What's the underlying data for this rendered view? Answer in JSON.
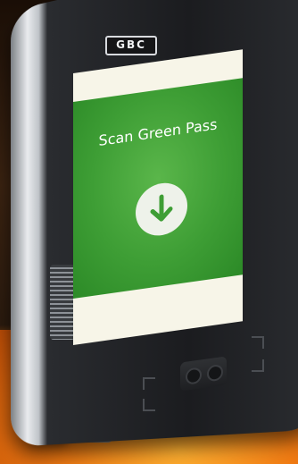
{
  "device": {
    "brand_logo": "GBC"
  },
  "screen": {
    "title": "Scan Green Pass",
    "action_icon": "arrow-down-icon",
    "colors": {
      "panel_green": "#3e9e35",
      "background": "#f7f5e8"
    }
  }
}
